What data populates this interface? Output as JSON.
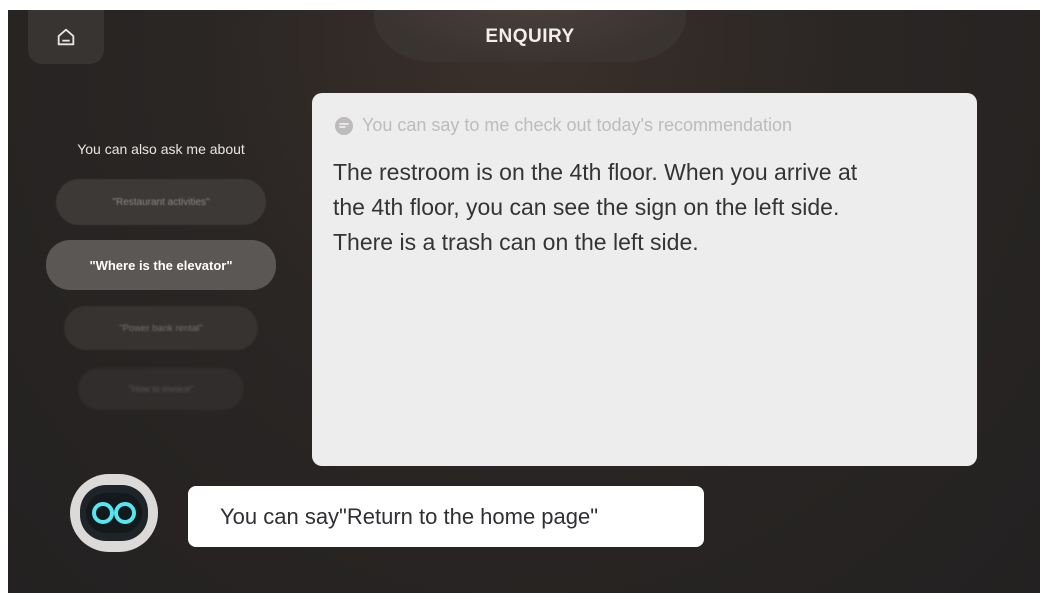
{
  "header": {
    "title": "ENQUIRY",
    "home_icon": "home-icon"
  },
  "sidebar": {
    "heading": "You can also ask me about",
    "suggestions": [
      "\"Restaurant activities\"",
      "\"Where is the elevator\"",
      "\"Power bank rental\"",
      "\"How to invoice\""
    ],
    "selected_index": 1
  },
  "answer_card": {
    "hint_icon": "voice-bubble-icon",
    "hint": "You can say to me check out today's recommendation",
    "answer_lines": [
      "The restroom is on the 4th floor. When you arrive at",
      "the 4th floor, you can see the sign on the left side.",
      "There is a trash can on the left side."
    ]
  },
  "assistant": {
    "avatar_icon": "robot-face-icon",
    "prompt": "You can say\"Return to the home page\""
  },
  "colors": {
    "background": "#2a2624",
    "card": "#eeedee",
    "selected_pill": "#5b5754",
    "bubble": "#ffffff"
  }
}
